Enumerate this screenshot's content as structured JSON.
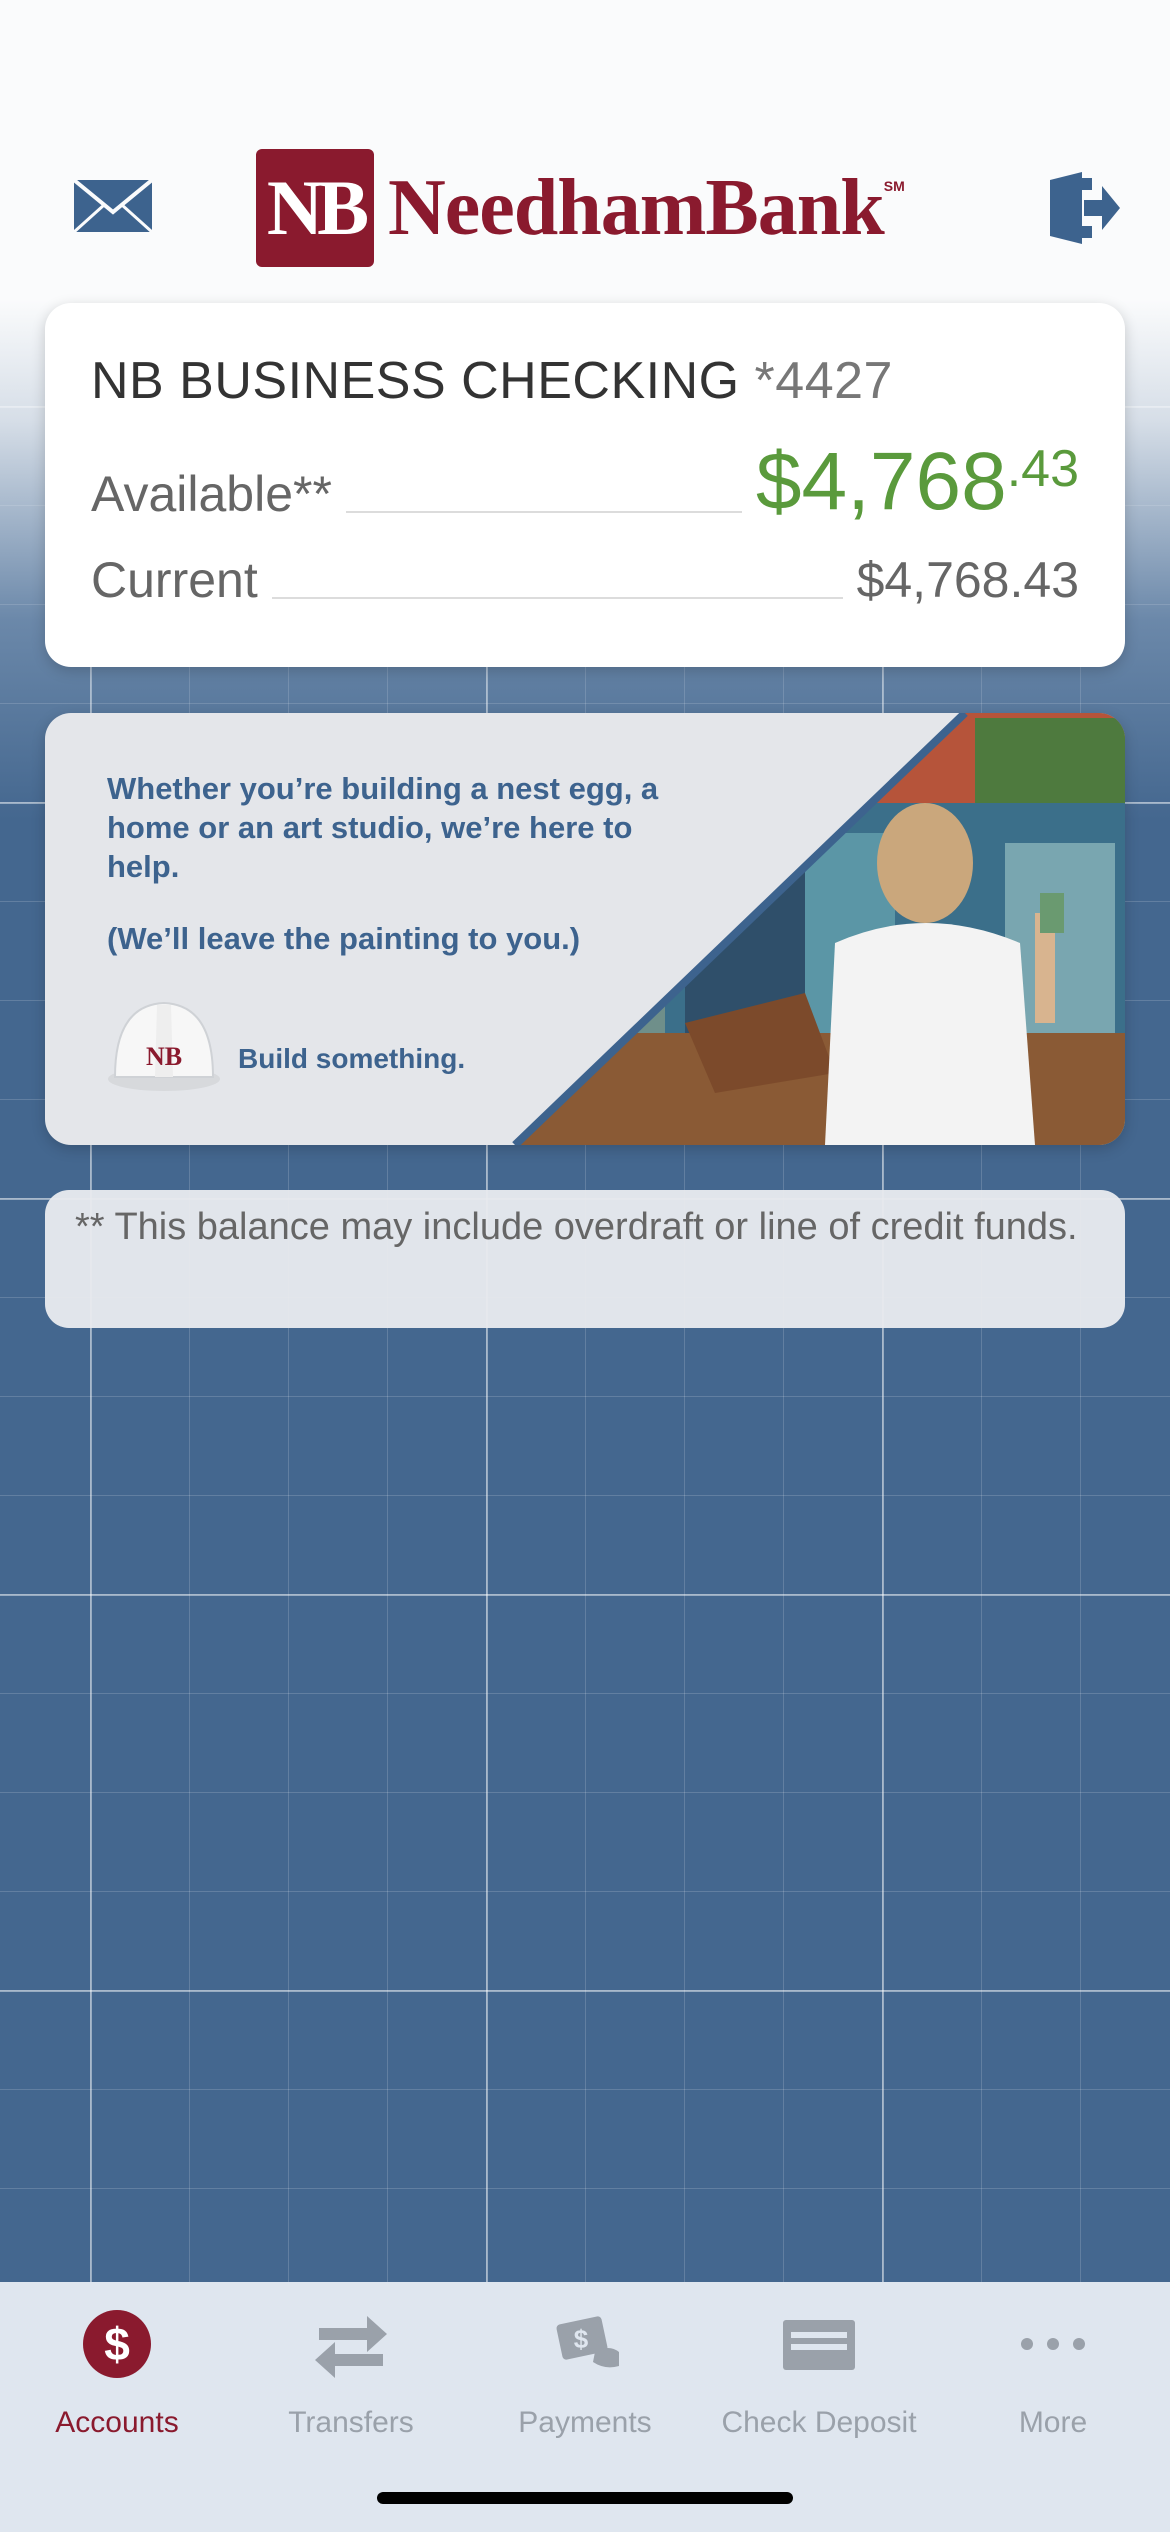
{
  "header": {
    "logo_mark": "NB",
    "logo_text": "NeedhamBank",
    "logo_sm": "SM"
  },
  "account": {
    "name": "NB BUSINESS CHECKING",
    "number": "*4427",
    "available_label": "Available**",
    "available_dollars": "$4,768",
    "available_cents": ".43",
    "current_label": "Current",
    "current_value": "$4,768.43"
  },
  "promo": {
    "line1": "Whether you’re building a nest egg, a home or an art studio, we’re here to help.",
    "line2": "(We’ll leave the painting to you.)",
    "helmet_mark": "NB",
    "tagline": "Build something."
  },
  "disclaimer": "** This balance may include overdraft or line of credit funds.",
  "tabs": [
    {
      "label": "Accounts",
      "icon": "dollar-circle-icon",
      "active": true
    },
    {
      "label": "Transfers",
      "icon": "transfer-arrows-icon",
      "active": false
    },
    {
      "label": "Payments",
      "icon": "payment-hand-icon",
      "active": false
    },
    {
      "label": "Check Deposit",
      "icon": "check-icon",
      "active": false
    },
    {
      "label": "More",
      "icon": "more-dots-icon",
      "active": false
    }
  ],
  "colors": {
    "brand": "#8a1a2e",
    "positive": "#5a9a3c",
    "blueprint": "#44678f",
    "promo_text": "#3d638e"
  }
}
